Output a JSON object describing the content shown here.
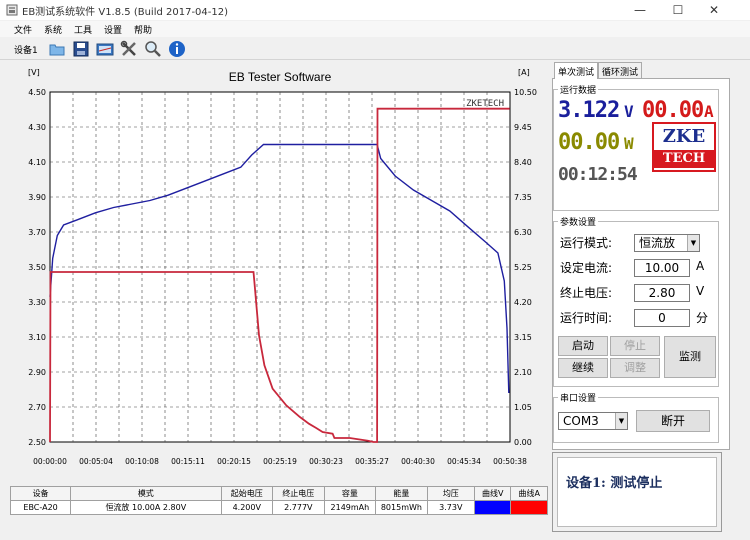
{
  "window": {
    "title": "EB测试系统软件 V1.8.5 (Build 2017-04-12)",
    "minimize": "—",
    "maximize": "☐",
    "close": "✕"
  },
  "menu": [
    "文件",
    "系统",
    "工具",
    "设置",
    "帮助"
  ],
  "toolbar": {
    "device_label": "设备1",
    "icons": [
      "folder-icon",
      "save-icon",
      "chart-icon",
      "tools-icon",
      "search-icon",
      "info-icon"
    ]
  },
  "chart_data": {
    "type": "line",
    "title": "EB Tester Software",
    "watermark": "ZKETECH",
    "left_unit": "[V]",
    "right_unit": "[A]",
    "ylim_left": [
      2.5,
      4.5
    ],
    "ylim_right": [
      0,
      10.5
    ],
    "left_ticks": [
      "4.50",
      "4.30",
      "4.10",
      "3.90",
      "3.70",
      "3.50",
      "3.30",
      "3.10",
      "2.90",
      "2.70",
      "2.50"
    ],
    "right_ticks": [
      "10.50",
      "9.45",
      "8.40",
      "7.35",
      "6.30",
      "5.25",
      "4.20",
      "3.15",
      "2.10",
      "1.05",
      "0.00"
    ],
    "x_ticks": [
      "00:00:00",
      "00:05:04",
      "00:10:08",
      "00:15:11",
      "00:20:15",
      "00:25:19",
      "00:30:23",
      "00:35:27",
      "00:40:30",
      "00:45:34",
      "00:50:38"
    ],
    "x_range_minutes": [
      0,
      50.63
    ],
    "grid": true,
    "series": [
      {
        "axis": "left",
        "color": "#1f1fa0",
        "points": [
          [
            0,
            3.33
          ],
          [
            0.3,
            3.55
          ],
          [
            0.8,
            3.68
          ],
          [
            1.5,
            3.74
          ],
          [
            3,
            3.77
          ],
          [
            5,
            3.81
          ],
          [
            7,
            3.84
          ],
          [
            9,
            3.86
          ],
          [
            11,
            3.88
          ],
          [
            13,
            3.91
          ],
          [
            15,
            3.95
          ],
          [
            17,
            3.99
          ],
          [
            19,
            4.03
          ],
          [
            21,
            4.07
          ],
          [
            22.2,
            4.14
          ],
          [
            23.5,
            4.2
          ],
          [
            30,
            4.2
          ],
          [
            36,
            4.2
          ],
          [
            36.4,
            4.12
          ],
          [
            38,
            4.02
          ],
          [
            40,
            3.94
          ],
          [
            42,
            3.88
          ],
          [
            44,
            3.82
          ],
          [
            46,
            3.73
          ],
          [
            48,
            3.64
          ],
          [
            49.3,
            3.58
          ],
          [
            50,
            3.42
          ],
          [
            50.3,
            3.15
          ],
          [
            50.5,
            2.78
          ]
        ]
      },
      {
        "axis": "right",
        "color": "#c8283c",
        "points": [
          [
            0,
            0
          ],
          [
            0.05,
            5.1
          ],
          [
            0.3,
            5.1
          ],
          [
            5,
            5.1
          ],
          [
            10,
            5.1
          ],
          [
            15,
            5.1
          ],
          [
            20,
            5.1
          ],
          [
            22.4,
            5.1
          ],
          [
            22.5,
            4.8
          ],
          [
            23,
            3.2
          ],
          [
            23.6,
            2.3
          ],
          [
            24.5,
            1.6
          ],
          [
            26,
            1.1
          ],
          [
            27.5,
            0.75
          ],
          [
            28.5,
            0.55
          ],
          [
            29.3,
            0.42
          ],
          [
            30,
            0.3
          ],
          [
            31.1,
            0.25
          ],
          [
            31.3,
            0.12
          ],
          [
            33,
            0.12
          ],
          [
            35,
            0.04
          ],
          [
            35.6,
            0
          ],
          [
            36,
            0
          ],
          [
            36.05,
            10
          ],
          [
            50.6,
            10
          ]
        ]
      }
    ]
  },
  "tabs": [
    "单次测试",
    "循环测试"
  ],
  "run_data": {
    "title": "运行数据",
    "voltage": "3.122",
    "voltage_unit": "V",
    "current": "00.00",
    "current_unit": "A",
    "power": "00.00",
    "power_unit": "W",
    "time": "00:12:54",
    "logo_top": "ZKE",
    "logo_bottom": "TECH"
  },
  "params": {
    "title": "参数设置",
    "mode_label": "运行模式:",
    "mode_value": "恒流放",
    "current_label": "设定电流:",
    "current_value": "10.00",
    "current_unit": "A",
    "cutoff_label": "终止电压:",
    "cutoff_value": "2.80",
    "cutoff_unit": "V",
    "time_label": "运行时间:",
    "time_value": "0",
    "time_unit": "分"
  },
  "controls": {
    "start": "启动",
    "stop": "停止",
    "continue": "继续",
    "adjust": "调整",
    "monitor": "监测"
  },
  "serial": {
    "title": "串口设置",
    "port": "COM3",
    "disconnect": "断开"
  },
  "status": "设备1: 测试停止",
  "table": {
    "headers": [
      "设备",
      "模式",
      "起始电压",
      "终止电压",
      "容量",
      "能量",
      "均压",
      "曲线V",
      "曲线A"
    ],
    "row": [
      "EBC-A20",
      "恒流放 10.00A 2.80V",
      "4.200V",
      "2.777V",
      "2149mAh",
      "8015mWh",
      "3.73V"
    ],
    "curve_v_color": "#0000ff",
    "curve_a_color": "#ff0000"
  }
}
